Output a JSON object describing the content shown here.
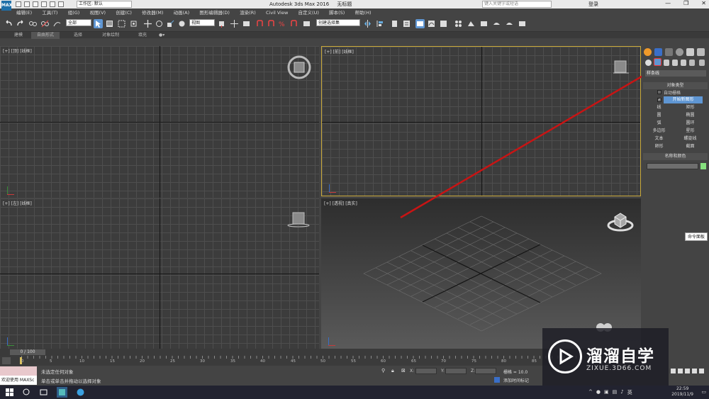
{
  "titlebar": {
    "logo": "MAX",
    "workspace": "工作区: 默认",
    "title": "Autodesk 3ds Max 2016",
    "subtitle": "无标题",
    "search_placeholder": "键入关键字或短语",
    "login": "登录",
    "minimize": "—",
    "restore": "❐",
    "close": "✕"
  },
  "menu": [
    "编辑(E)",
    "工具(T)",
    "组(G)",
    "视图(V)",
    "创建(C)",
    "修改器(M)",
    "动画(A)",
    "图形编辑器(D)",
    "渲染(R)",
    "Civil View",
    "自定义(U)",
    "脚本(S)",
    "帮助(H)"
  ],
  "toolbar": {
    "selection_filter": "全部",
    "reference_coord": "视图",
    "named_selection": "创建选择集"
  },
  "ribbon": {
    "tabs": [
      "建模",
      "自由形式",
      "选择",
      "对象绘制",
      "填充"
    ],
    "active_tab": "自由形式"
  },
  "viewports": {
    "top": "[+] [顶] [线框]",
    "front": "[+] [前] [线框]",
    "left": "[+] [左] [线框]",
    "perspective": "[+] [透视] [真实]"
  },
  "command_panel": {
    "category": "样条线",
    "object_type_header": "对象类型",
    "auto_grid": "自动栅格",
    "start_new_shape": "开始新图形",
    "buttons": [
      [
        "线",
        "矩形"
      ],
      [
        "圆",
        "椭圆"
      ],
      [
        "弧",
        "圆环"
      ],
      [
        "多边形",
        "星形"
      ],
      [
        "文本",
        "螺旋线"
      ],
      [
        "卵形",
        "截面"
      ]
    ],
    "name_color_header": "名称和颜色",
    "swatch_color": "#86e07e",
    "tooltip": "命令面板"
  },
  "timeline": {
    "frame": "0 / 100",
    "ticks": [
      "0",
      "5",
      "10",
      "15",
      "20",
      "25",
      "30",
      "35",
      "40",
      "45",
      "50",
      "55",
      "60",
      "65",
      "70",
      "75",
      "80",
      "85",
      "90",
      "95",
      "100"
    ]
  },
  "status": {
    "maxscript_top": "",
    "maxscript_bottom": "欢迎使用 MAXSc",
    "line1": "未选定任何对象",
    "line2": "单击或单击并拖动以选择对象",
    "x_label": "X:",
    "y_label": "Y:",
    "z_label": "Z:",
    "grid": "栅格 = 10.0",
    "add_time_tag": "添加时间标记"
  },
  "taskbar": {
    "time": "22:59",
    "date": "2019/11/9",
    "ime": "英"
  },
  "watermark": {
    "main": "溜溜自学",
    "sub": "ZIXUE.3D66.COM"
  },
  "colors": {
    "accent": "#5f96d3",
    "arrow": "#c81414",
    "viewport_bg": "#3c3c3c",
    "active_border": "#c9a93a"
  }
}
